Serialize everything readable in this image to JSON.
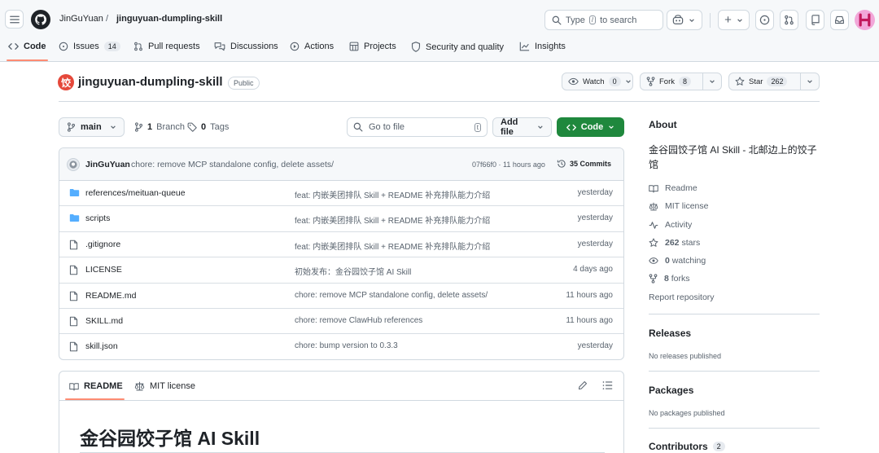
{
  "header": {
    "owner": "JinGuYuan",
    "separator": "/",
    "repo": "jinguyuan-dumpling-skill",
    "search_text_before": "Type",
    "search_key": "/",
    "search_text_after": "to search",
    "plus_label": "+"
  },
  "tabs": [
    {
      "label": "Code",
      "icon": "code-icon"
    },
    {
      "label": "Issues",
      "count": "14",
      "icon": "issue-icon"
    },
    {
      "label": "Pull requests",
      "icon": "pull-request-icon"
    },
    {
      "label": "Discussions",
      "icon": "discussions-icon"
    },
    {
      "label": "Actions",
      "icon": "play-icon"
    },
    {
      "label": "Projects",
      "icon": "table-icon"
    },
    {
      "label": "Security and quality",
      "icon": "shield-icon"
    },
    {
      "label": "Insights",
      "icon": "graph-icon"
    }
  ],
  "repo": {
    "name": "jinguyuan-dumpling-skill",
    "visibility": "Public",
    "avatar_glyph": "饺",
    "watch_label": "Watch",
    "watch_count": "0",
    "fork_label": "Fork",
    "fork_count": "8",
    "star_label": "Star",
    "star_count": "262"
  },
  "branch": {
    "name": "main",
    "branch_count": "1",
    "branch_label": "Branch",
    "tag_count": "0",
    "tag_label": "Tags",
    "goto_placeholder": "Go to file",
    "goto_key": "t",
    "add_file_label": "Add file",
    "code_label": "Code"
  },
  "commit": {
    "author": "JinGuYuan",
    "message": "chore: remove MCP standalone config, delete assets/",
    "sha_time": "07f66f0 · 11 hours ago",
    "commits_label": "35 Commits"
  },
  "files": [
    {
      "type": "folder",
      "name": "references/meituan-queue",
      "message": "feat: 内嵌美团排队 Skill + README 补充排队能力介绍",
      "date": "yesterday"
    },
    {
      "type": "folder",
      "name": "scripts",
      "message": "feat: 内嵌美团排队 Skill + README 补充排队能力介绍",
      "date": "yesterday"
    },
    {
      "type": "file",
      "name": ".gitignore",
      "message": "feat: 内嵌美团排队 Skill + README 补充排队能力介绍",
      "date": "yesterday"
    },
    {
      "type": "file",
      "name": "LICENSE",
      "message": "初始发布：金谷园饺子馆 AI Skill",
      "date": "4 days ago"
    },
    {
      "type": "file",
      "name": "README.md",
      "message": "chore: remove MCP standalone config, delete assets/",
      "date": "11 hours ago"
    },
    {
      "type": "file",
      "name": "SKILL.md",
      "message": "chore: remove ClawHub references",
      "date": "11 hours ago"
    },
    {
      "type": "file",
      "name": "skill.json",
      "message": "chore: bump version to 0.3.3",
      "date": "yesterday"
    }
  ],
  "readme": {
    "tab_readme": "README",
    "tab_license": "MIT license",
    "title": "金谷园饺子馆 AI Skill"
  },
  "sidebar": {
    "about_title": "About",
    "description": "金谷园饺子馆 AI Skill - 北邮边上的饺子馆",
    "links": [
      {
        "label": "Readme",
        "icon": "book-icon"
      },
      {
        "label": "MIT license",
        "icon": "law-icon"
      },
      {
        "label": "Activity",
        "icon": "pulse-icon"
      },
      {
        "bold": "262",
        "label": "stars",
        "icon": "star-icon"
      },
      {
        "bold": "0",
        "label": "watching",
        "icon": "eye-icon"
      },
      {
        "bold": "8",
        "label": "forks",
        "icon": "fork-icon"
      }
    ],
    "report": "Report repository",
    "releases_title": "Releases",
    "releases_text": "No releases published",
    "packages_title": "Packages",
    "packages_text": "No packages published",
    "contributors_title": "Contributors",
    "contributors_count": "2"
  },
  "colors": {
    "accent_green": "#1f883d",
    "tab_underline": "#fd8c73",
    "folder_blue": "#54aeff",
    "avatar_red": "#e5483a",
    "user_avatar_pink": "#f2a7d9"
  }
}
